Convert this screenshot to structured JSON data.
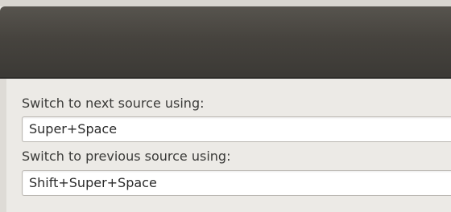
{
  "shortcuts": {
    "next_label": "Switch to next source using:",
    "next_value": "Super+Space",
    "prev_label": "Switch to previous source using:",
    "prev_value": "Shift+Super+Space"
  }
}
